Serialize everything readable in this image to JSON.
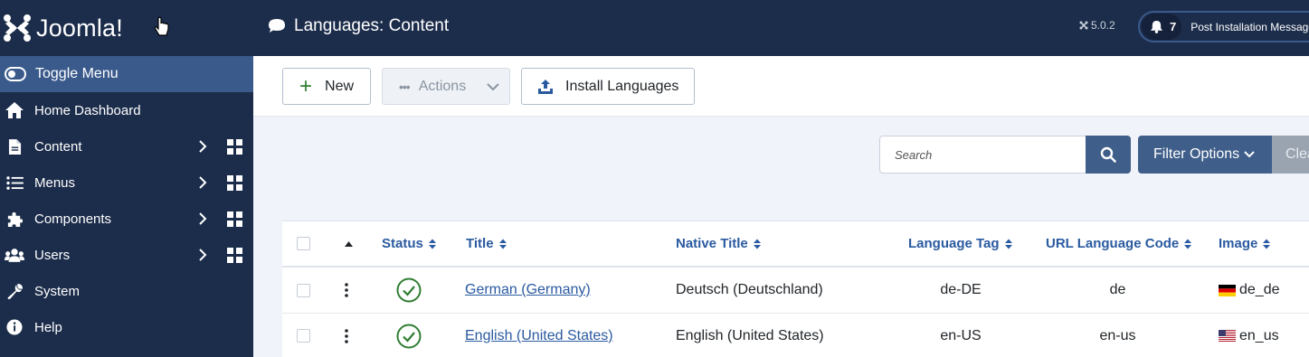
{
  "sidebar": {
    "brand": "Joomla!",
    "toggle_label": "Toggle Menu",
    "items": [
      {
        "label": "Home Dashboard",
        "icon": "home-icon"
      },
      {
        "label": "Content",
        "icon": "file-icon"
      },
      {
        "label": "Menus",
        "icon": "list-icon"
      },
      {
        "label": "Components",
        "icon": "puzzle-icon"
      },
      {
        "label": "Users",
        "icon": "users-icon"
      },
      {
        "label": "System",
        "icon": "wrench-icon"
      },
      {
        "label": "Help",
        "icon": "info-icon"
      }
    ]
  },
  "header": {
    "title": "Languages: Content",
    "version": "5.0.2",
    "notifications_count": "7",
    "post_install_label": "Post Installation Messages"
  },
  "toolbar": {
    "new_label": "New",
    "actions_label": "Actions",
    "install_label": "Install Languages"
  },
  "search": {
    "placeholder": "Search",
    "filter_label": "Filter Options",
    "clear_label": "Clear"
  },
  "table": {
    "columns": [
      "Status",
      "Title",
      "Native Title",
      "Language Tag",
      "URL Language Code",
      "Image"
    ],
    "rows": [
      {
        "title": "German (Germany)",
        "native_title": "Deutsch (Deutschland)",
        "tag": "de-DE",
        "url_code": "de",
        "image": "de_de"
      },
      {
        "title": "English (United States)",
        "native_title": "English (United States)",
        "tag": "en-US",
        "url_code": "en-us",
        "image": "en_us"
      }
    ]
  },
  "colors": {
    "sidebar_bg": "#1c2d4b",
    "toggle_bg": "#3a5a8c",
    "accent": "#3f5e8a",
    "link": "#2a5aa0",
    "success": "#2f7d32"
  }
}
